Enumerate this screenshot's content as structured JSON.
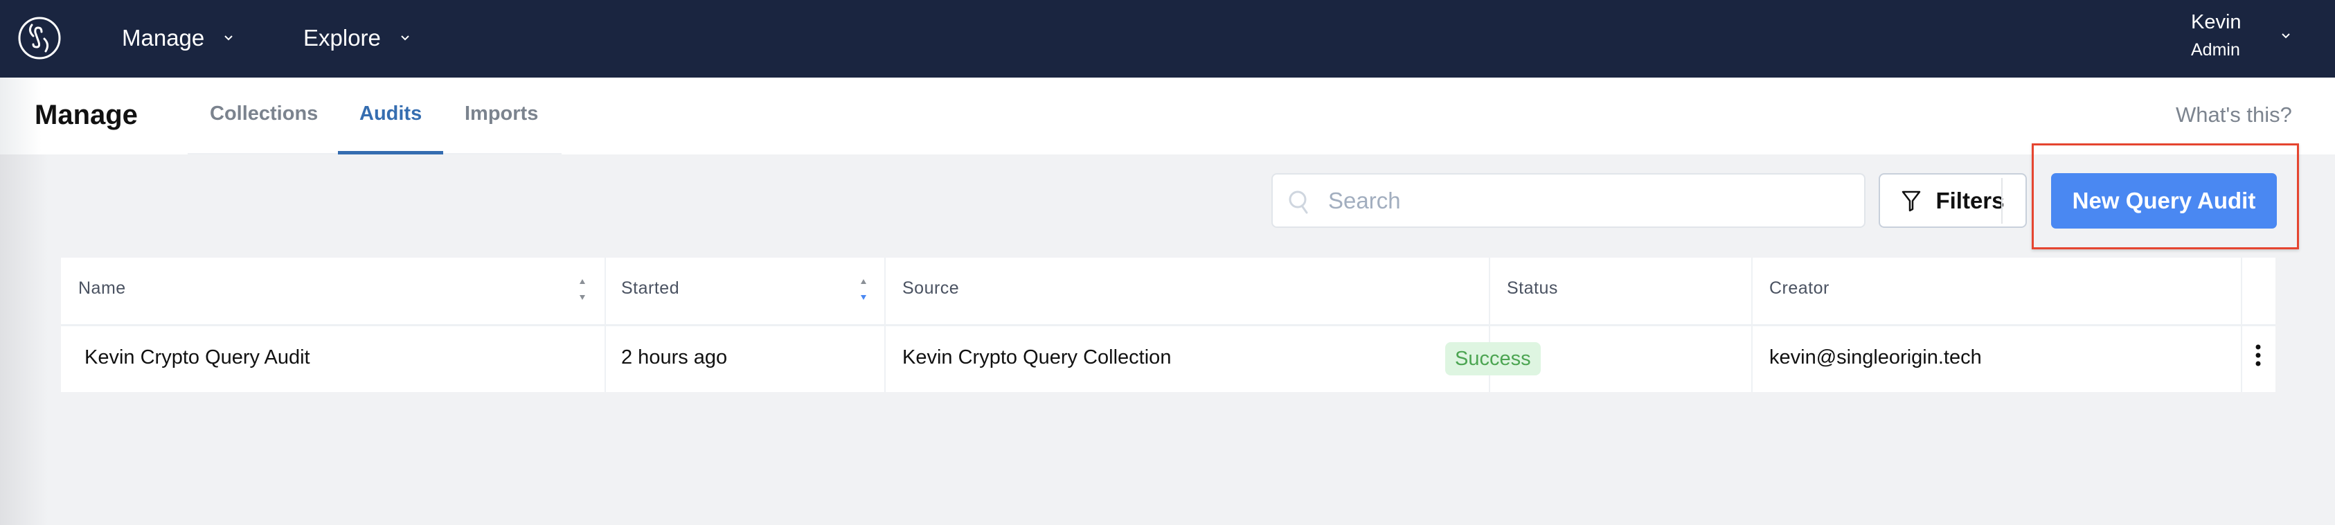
{
  "navbar": {
    "logo": "single-origin-logo",
    "items": [
      {
        "label": "Manage",
        "icon": "chevron-down-icon"
      },
      {
        "label": "Explore",
        "icon": "chevron-down-icon"
      }
    ],
    "user": {
      "name": "Kevin",
      "role": "Admin",
      "icon": "chevron-down-icon"
    }
  },
  "subheader": {
    "title": "Manage",
    "tabs": [
      {
        "label": "Collections",
        "active": false
      },
      {
        "label": "Audits",
        "active": true
      },
      {
        "label": "Imports",
        "active": false
      }
    ],
    "help_link": "What's this?"
  },
  "toolbar": {
    "search": {
      "placeholder": "Search",
      "value": "",
      "icon": "search-icon"
    },
    "filters_label": "Filters",
    "filters_icon": "filter-icon",
    "new_button_label": "New Query Audit"
  },
  "colors": {
    "navbar_bg": "#1a2540",
    "accent": "#356db0",
    "primary_button": "#4a88f2",
    "highlight": "#e54530",
    "success_bg": "#def5e1",
    "success_text": "#4ca552"
  },
  "table": {
    "columns": [
      {
        "label": "Name",
        "sortable": true,
        "sort": "none"
      },
      {
        "label": "Started",
        "sortable": true,
        "sort": "descending"
      },
      {
        "label": "Source",
        "sortable": false
      },
      {
        "label": "Status",
        "sortable": false
      },
      {
        "label": "Creator",
        "sortable": false
      }
    ],
    "rows": [
      {
        "name": "Kevin Crypto Query Audit",
        "started": "2 hours ago",
        "source": "Kevin Crypto Query Collection",
        "status": "Success",
        "creator": "kevin@singleorigin.tech"
      }
    ]
  }
}
